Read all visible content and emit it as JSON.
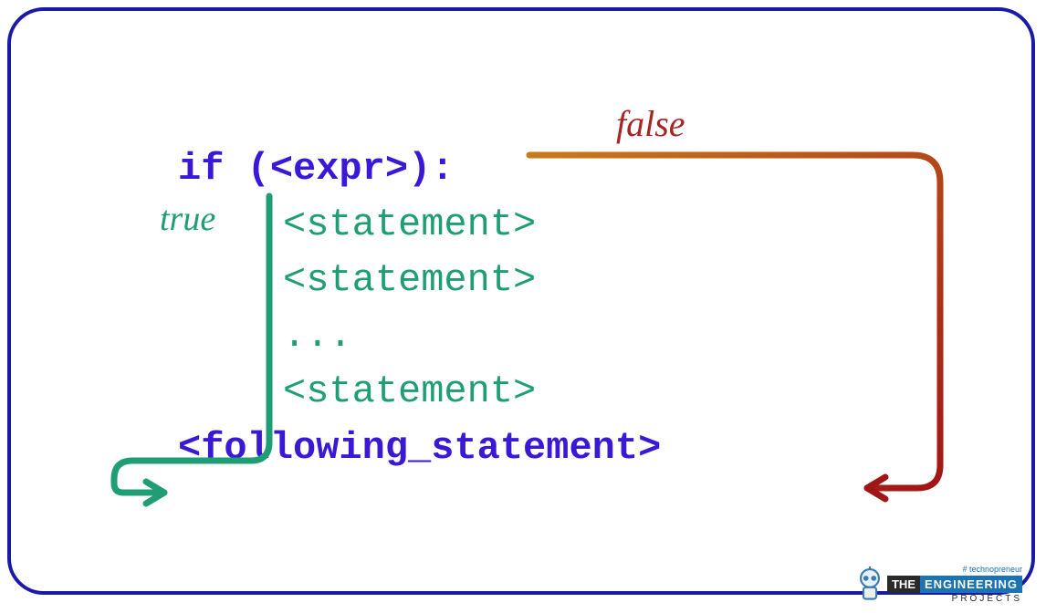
{
  "code": {
    "if_line": "if (<expr>):",
    "statements": [
      "<statement>",
      "<statement>",
      "...",
      "<statement>"
    ],
    "following": "<following_statement>"
  },
  "labels": {
    "true": "true",
    "false": "false"
  },
  "logo": {
    "tag": "# technopreneur",
    "the": "THE",
    "eng": "ENGINEERING",
    "proj": "PROJECTS"
  }
}
